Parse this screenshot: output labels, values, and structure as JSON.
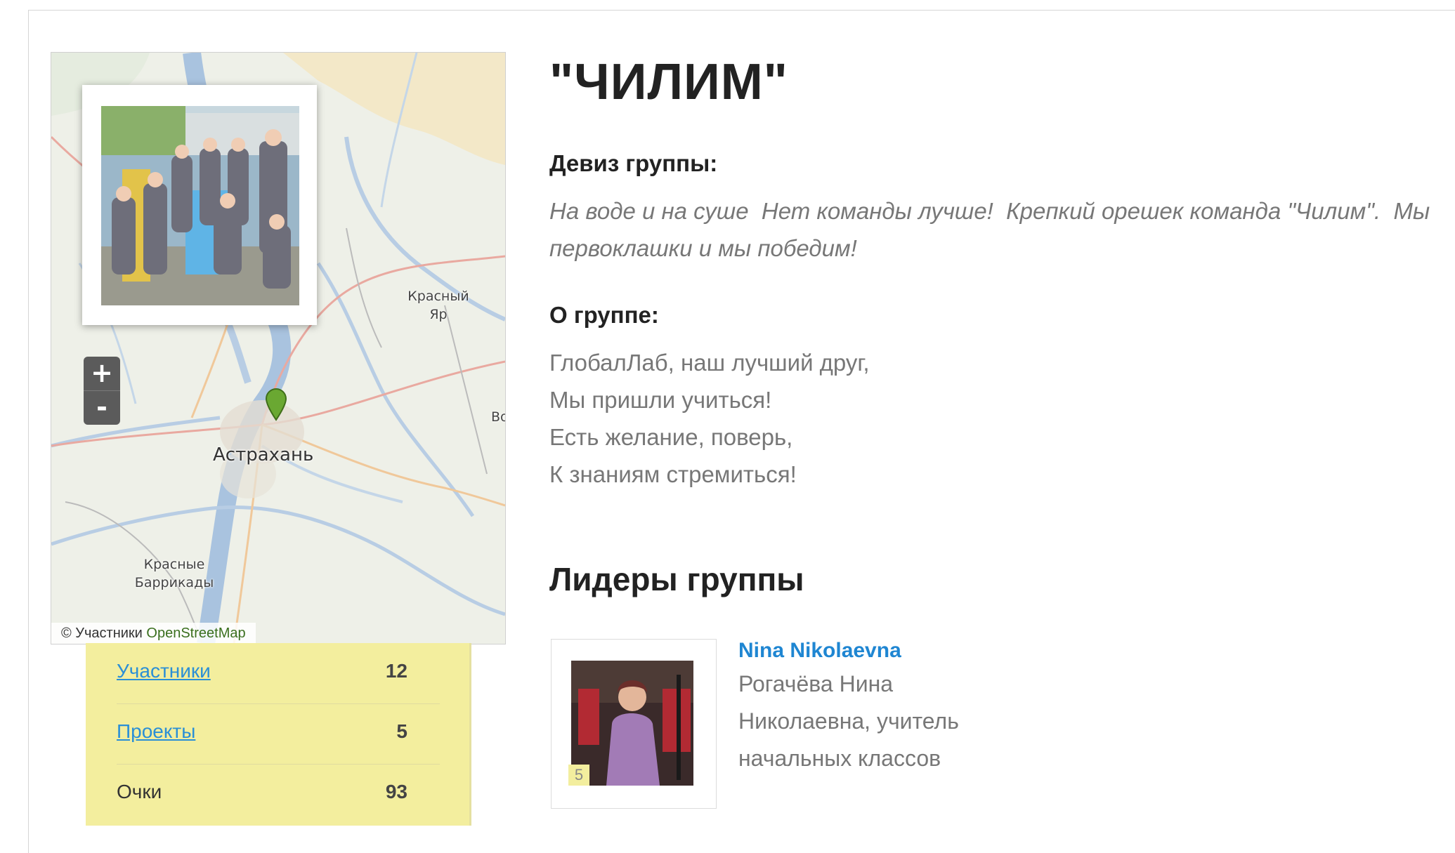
{
  "group": {
    "title": "\"ЧИЛИМ\"",
    "motto_heading": "Девиз группы:",
    "motto": "На воде и на суше  Нет команды лучше!  Крепкий орешек команда \"Чилим\".  Мы первоклашки и мы победим!",
    "about_heading": "О группе:",
    "about_lines": [
      "ГлобалЛаб, наш лучший друг,",
      "Мы пришли учиться!",
      "Есть желание, поверь,",
      "К знаниям стремиться!"
    ]
  },
  "map": {
    "zoom_in": "+",
    "zoom_out": "-",
    "labels": {
      "city": "Астрахань",
      "krasny_yar": "Красный Яр",
      "krasnye_barrikady": "Красные Баррикады",
      "edge": "Во"
    },
    "attribution_prefix": "© Участники",
    "attribution_link": "OpenStreetMap"
  },
  "stats": {
    "rows": [
      {
        "label": "Участники",
        "value": "12"
      },
      {
        "label": "Проекты",
        "value": "5"
      },
      {
        "label": "Очки",
        "value": "93"
      }
    ]
  },
  "leaders": {
    "title": "Лидеры группы",
    "items": [
      {
        "name": "Nina Nikolaevna",
        "description": "Рогачёва Нина Николаевна, учитель начальных классов",
        "badge": "5"
      }
    ]
  },
  "colors": {
    "link": "#1f86d2",
    "stats_bg": "#f3ee9e",
    "marker": "#6aa832"
  }
}
